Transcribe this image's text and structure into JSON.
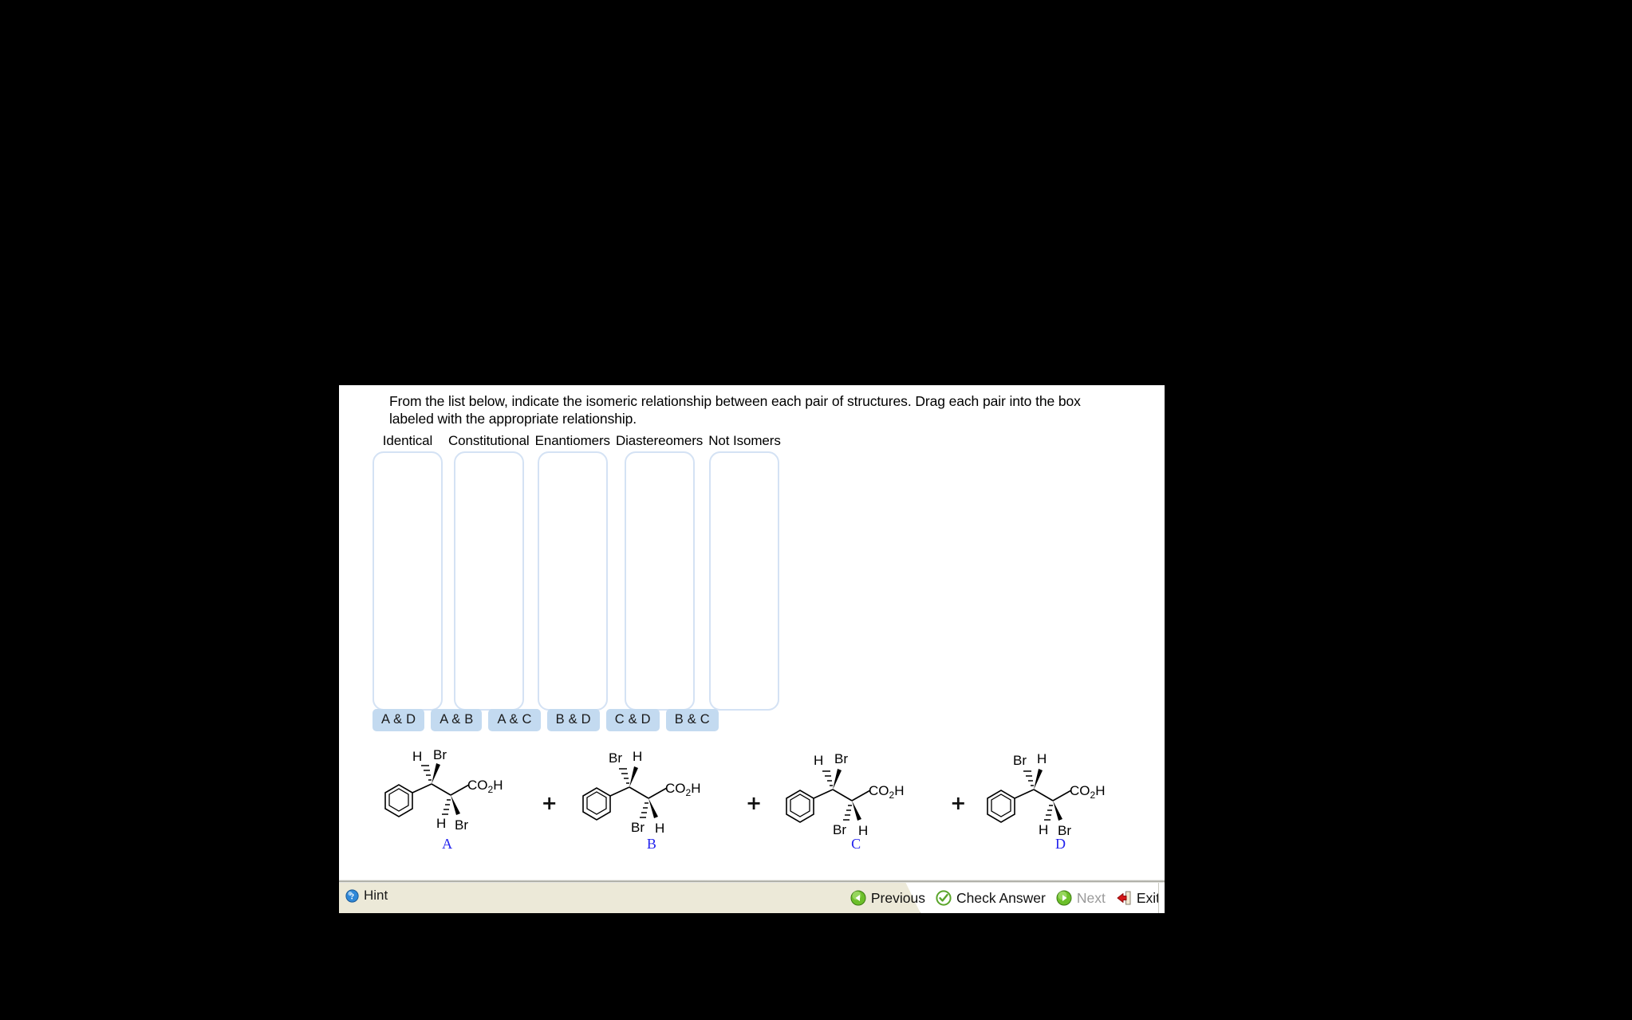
{
  "instruction": "From the list below, indicate the isomeric relationship between each pair of structures. Drag each pair into the box labeled with the appropriate relationship.",
  "dropzones": [
    {
      "label": "Identical",
      "contents": ""
    },
    {
      "label": "Constitutional",
      "contents": ""
    },
    {
      "label": "Enantiomers",
      "contents": ""
    },
    {
      "label": "Diastereomers",
      "contents": ""
    },
    {
      "label": "Not Isomers",
      "contents": ""
    }
  ],
  "pair_chips": [
    {
      "label": "A & D"
    },
    {
      "label": "A & B"
    },
    {
      "label": "A & C"
    },
    {
      "label": "B & D"
    },
    {
      "label": "C & D"
    },
    {
      "label": "B & C"
    }
  ],
  "structures": [
    {
      "letter": "A",
      "top_left": "H",
      "top_right": "Br",
      "bottom_left": "H",
      "bottom_right": "Br",
      "acid": "CO",
      "acid_sub": "2",
      "acid_tail": "H",
      "top_left_bond": "hash",
      "top_right_bond": "wedge",
      "bottom_left_bond": "hash",
      "bottom_right_bond": "wedge"
    },
    {
      "letter": "B",
      "top_left": "Br",
      "top_right": "H",
      "bottom_left": "Br",
      "bottom_right": "H",
      "acid": "CO",
      "acid_sub": "2",
      "acid_tail": "H",
      "top_left_bond": "hash",
      "top_right_bond": "wedge",
      "bottom_left_bond": "hash",
      "bottom_right_bond": "wedge"
    },
    {
      "letter": "C",
      "top_left": "H",
      "top_right": "Br",
      "bottom_left": "Br",
      "bottom_right": "H",
      "acid": "CO",
      "acid_sub": "2",
      "acid_tail": "H",
      "top_left_bond": "hash",
      "top_right_bond": "wedge",
      "bottom_left_bond": "hash",
      "bottom_right_bond": "wedge"
    },
    {
      "letter": "D",
      "top_left": "Br",
      "top_right": "H",
      "bottom_left": "H",
      "bottom_right": "Br",
      "acid": "CO",
      "acid_sub": "2",
      "acid_tail": "H",
      "top_left_bond": "hash",
      "top_right_bond": "wedge",
      "bottom_left_bond": "hash",
      "bottom_right_bond": "wedge"
    }
  ],
  "separators": [
    "+",
    "+",
    "+"
  ],
  "bottom_bar": {
    "hint_label": "Hint",
    "hint_icon": "lightbulb-icon",
    "buttons": [
      {
        "label": "Previous",
        "icon": "back-arrow-icon",
        "disabled": false
      },
      {
        "label": "Check Answer",
        "icon": "check-circle-icon",
        "disabled": false
      },
      {
        "label": "Next",
        "icon": "forward-arrow-icon",
        "disabled": true
      },
      {
        "label": "Exit",
        "icon": "exit-door-icon",
        "disabled": false
      }
    ]
  },
  "colors": {
    "panel_background": "#ffffff",
    "page_background": "#000000",
    "chip_background": "#c3daf0",
    "dropzone_border": "#d4e2f4",
    "structure_letter": "#2222ee",
    "hintbar_background": "#ece9d8",
    "disabled_text": "#9a9a9a",
    "green_icon": "#5aa52b",
    "red_icon": "#cc1111"
  }
}
